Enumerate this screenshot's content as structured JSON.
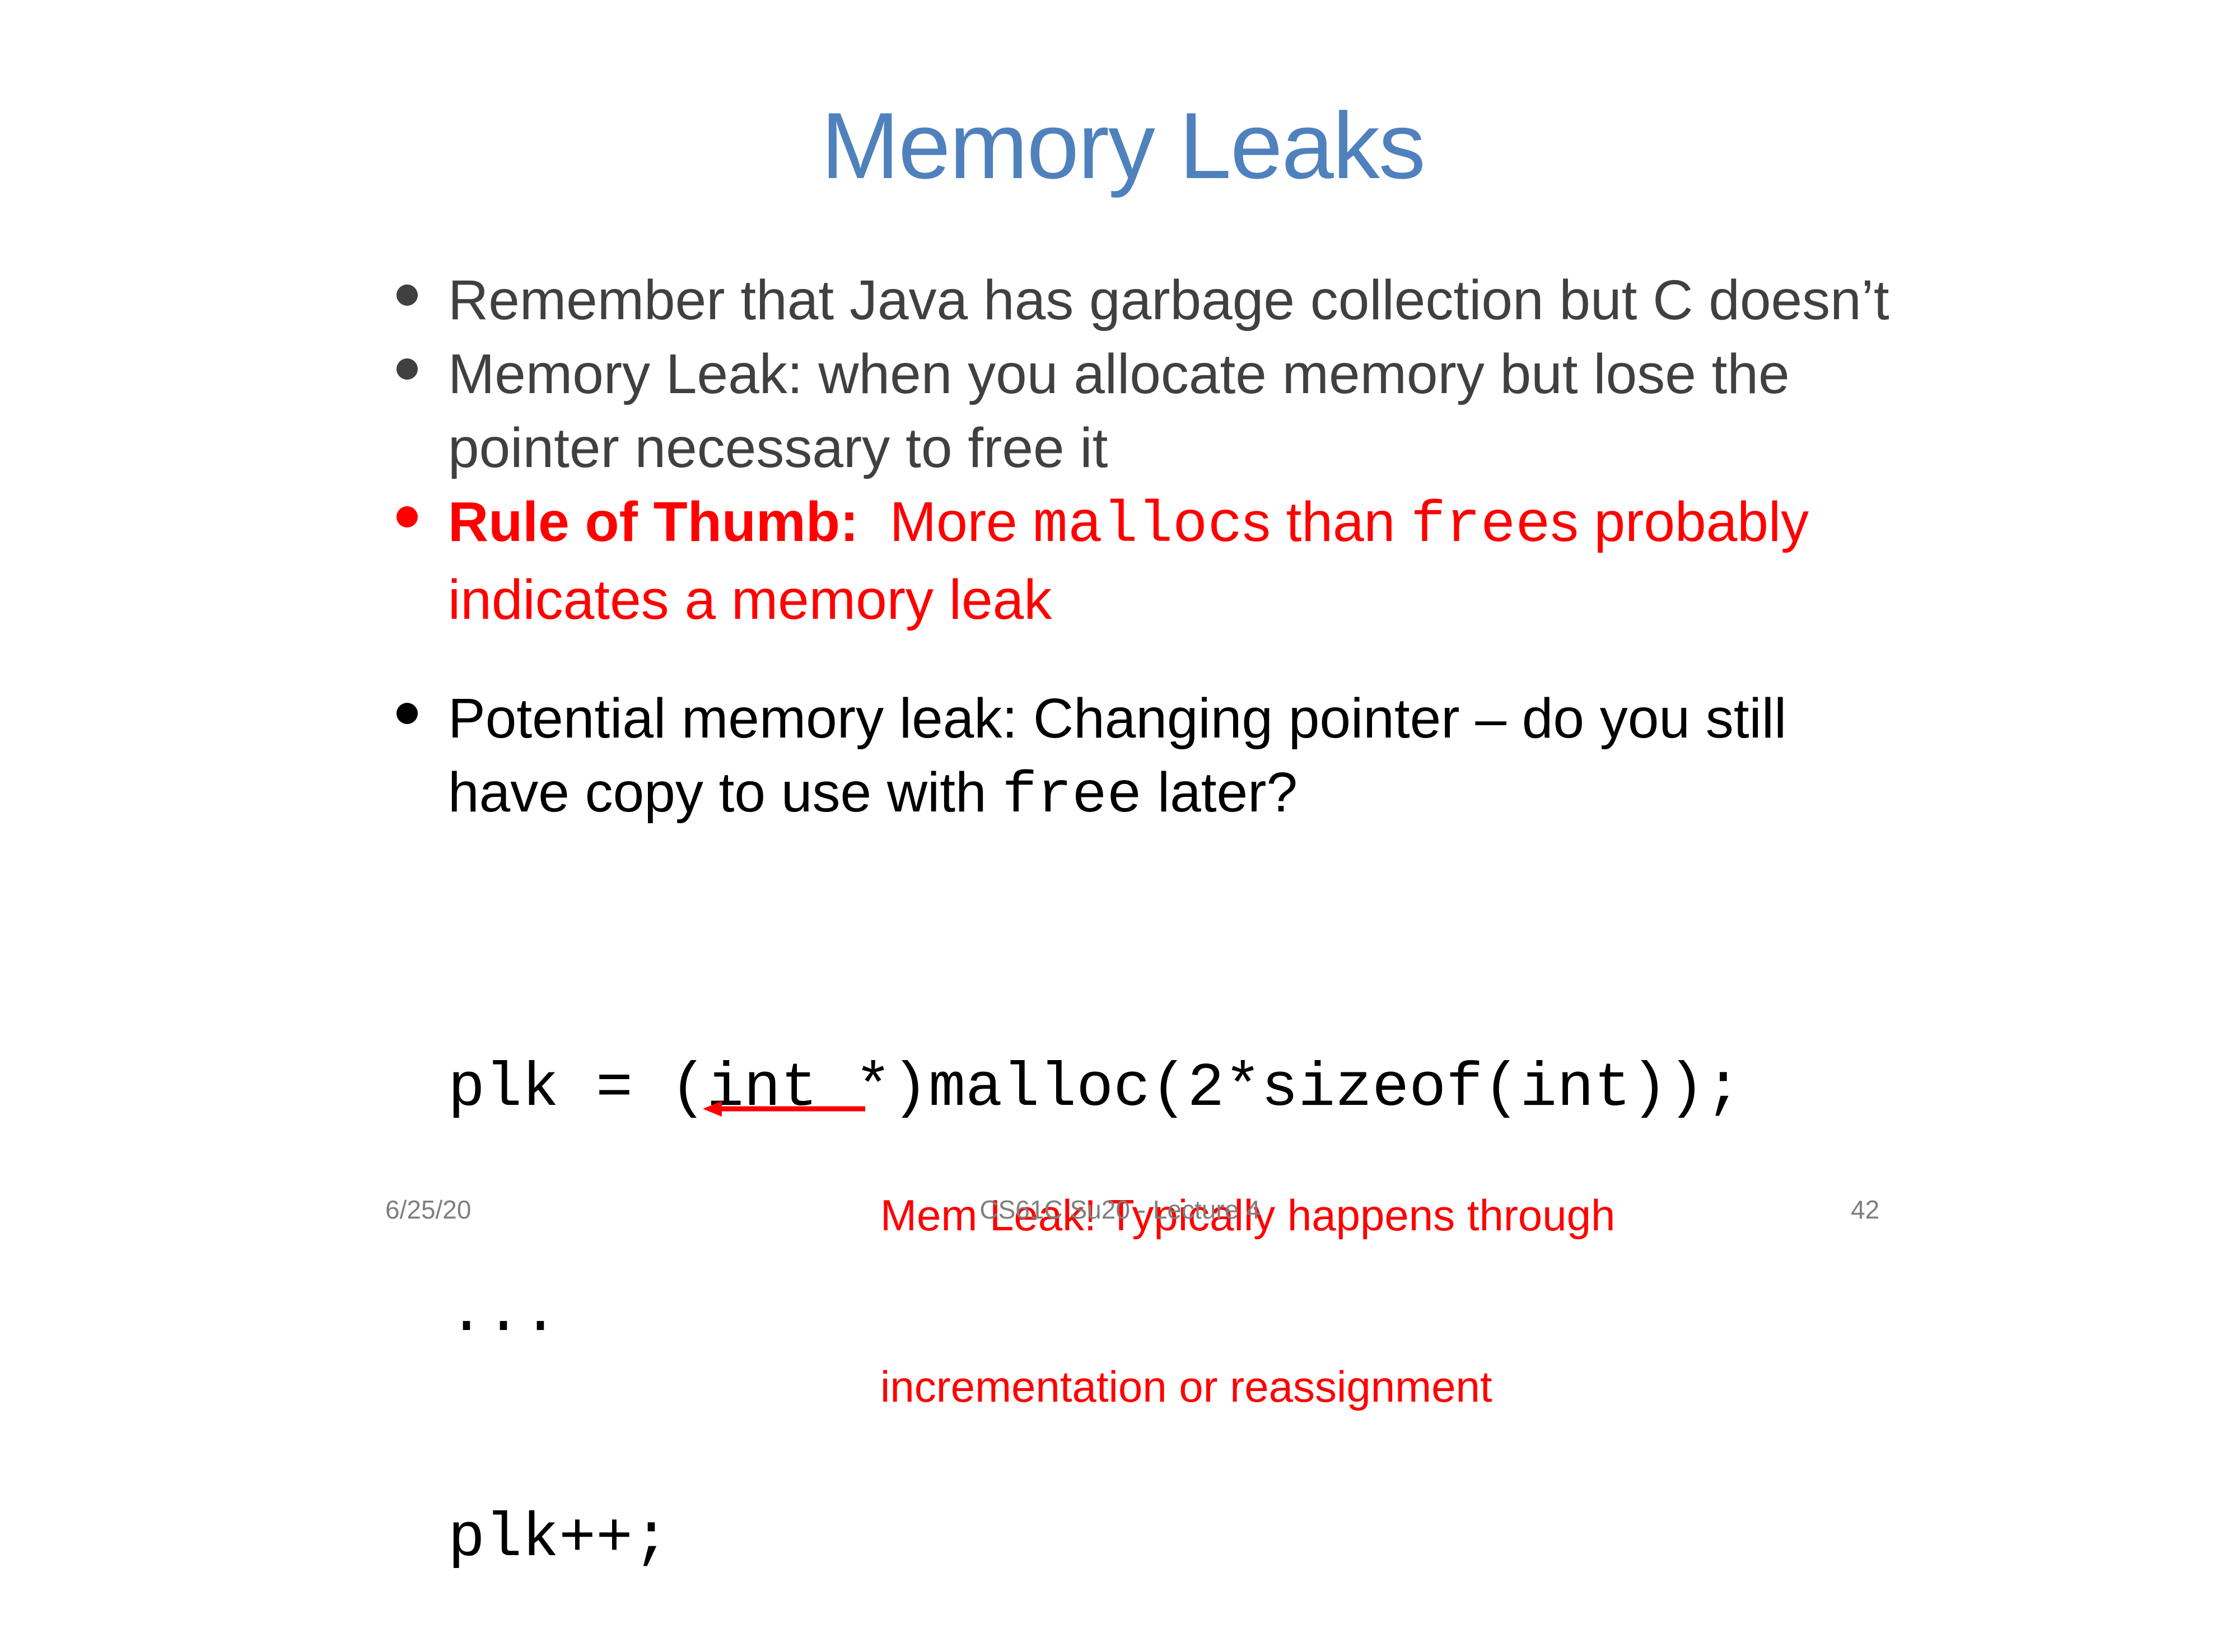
{
  "title": "Memory Leaks",
  "bullets": {
    "b1": "Remember that Java has garbage collection but C doesn’t",
    "b2_line1": "Memory Leak: when you allocate memory but lose the",
    "b2_line2": "pointer necessary to free it",
    "b3_bold": "Rule of Thumb:",
    "b3_more": "  More ",
    "b3_malloc": "malloc",
    "b3_s_than": "s than ",
    "b3_free": "free",
    "b3_s_probably": "s probably",
    "b3_line2": "indicates a memory leak",
    "b4_line1": "Potential memory leak:  Changing pointer – do you still",
    "b4_have": "have copy to use with ",
    "b4_free": "free",
    "b4_later": " later?"
  },
  "code": {
    "line1": "plk = (int *)malloc(2*sizeof(int));",
    "line2": "...",
    "line3": "plk++;"
  },
  "annotation": {
    "line1": "Mem Leak! Typically happens through",
    "line2": "incrementation or reassignment"
  },
  "footer": {
    "date": "6/25/20",
    "course": "CS61C Su20 - Lecture 4",
    "page": "42"
  },
  "colors": {
    "title": "#4f81bd",
    "body_gray": "#404040",
    "highlight_red": "#ff0000",
    "footer_gray": "#7f7f7f"
  }
}
